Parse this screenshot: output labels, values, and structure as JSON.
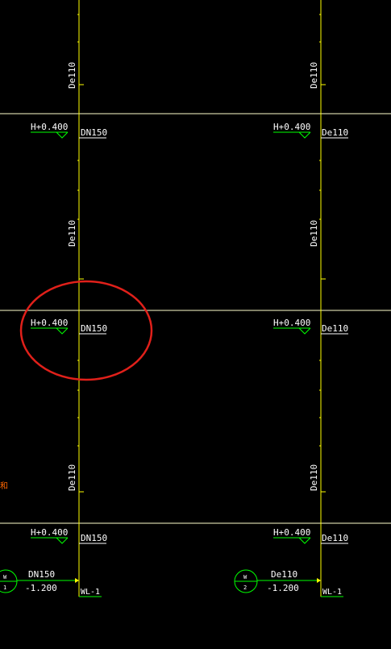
{
  "colors": {
    "background": "#000000",
    "pipe": "#ffff00",
    "floor_line": "#ffffcc",
    "elevation_text": "#ffffff",
    "elevation_mark": "#00ff00",
    "riser_label": "#ffffff",
    "annotation_circle": "#e0201a",
    "stray_text": "#ff6600"
  },
  "floors": {
    "elevation_label": "H+0.400",
    "left_riser_sizes": [
      "DN150",
      "DN150",
      "DN150"
    ],
    "right_riser_sizes": [
      "De110",
      "De110",
      "De110"
    ]
  },
  "vertical_pipe_labels": {
    "left": [
      "De110",
      "De110",
      "De110"
    ],
    "right": [
      "De110",
      "De110",
      "De110"
    ]
  },
  "outlets": {
    "left": {
      "symbol_top": "W",
      "symbol_bottom": "1",
      "size": "DN150",
      "elevation": "-1.200",
      "riser_tag": "WL-1"
    },
    "right": {
      "symbol_top": "W",
      "symbol_bottom": "2",
      "size": "De110",
      "elevation": "-1.200",
      "riser_tag": "WL-1"
    }
  },
  "stray_text": "和"
}
